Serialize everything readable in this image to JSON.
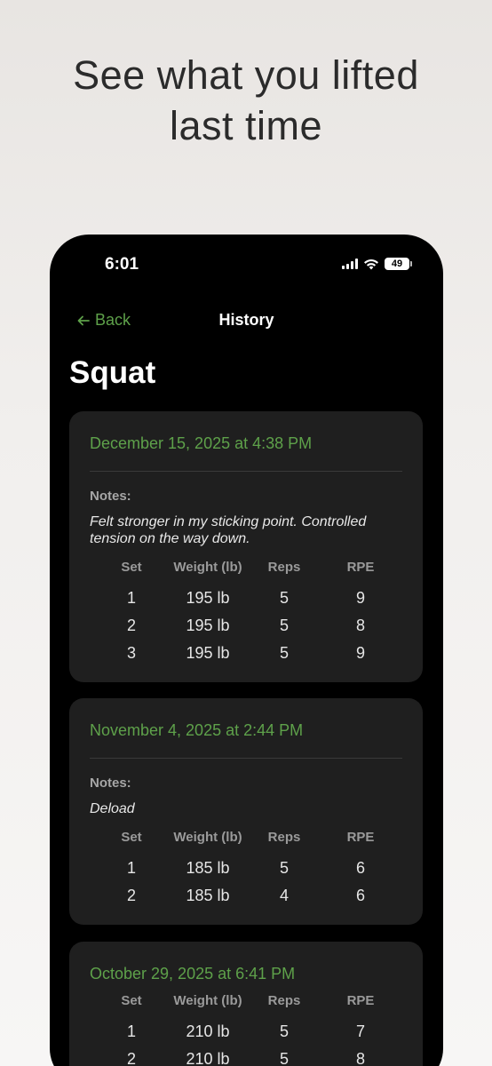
{
  "headline": {
    "line1": "See what you lifted",
    "line2": "last time"
  },
  "status_bar": {
    "time": "6:01",
    "battery": "49",
    "icons": [
      "signal-icon",
      "wifi-icon",
      "battery-icon"
    ]
  },
  "nav": {
    "back_label": "Back",
    "back_icon": "arrow-left-icon",
    "title": "History"
  },
  "exercise": "Squat",
  "colors": {
    "accent": "#5ea14a",
    "card": "#1f1f1f",
    "screen": "#000000"
  },
  "columns": [
    "Set",
    "Weight (lb)",
    "Reps",
    "RPE"
  ],
  "sessions": [
    {
      "date": "December 15, 2025 at 4:38 PM",
      "notes_label": "Notes:",
      "notes_line1": "Felt stronger in my sticking point. Controlled",
      "notes_line2": "tension on the way down.",
      "sets": [
        [
          "1",
          "195 lb",
          "5",
          "9"
        ],
        [
          "2",
          "195 lb",
          "5",
          "8"
        ],
        [
          "3",
          "195 lb",
          "5",
          "9"
        ]
      ]
    },
    {
      "date": "November 4, 2025 at 2:44 PM",
      "notes_label": "Notes:",
      "notes_line1": "Deload",
      "sets": [
        [
          "1",
          "185 lb",
          "5",
          "6"
        ],
        [
          "2",
          "185 lb",
          "4",
          "6"
        ]
      ]
    },
    {
      "date": "October 29, 2025 at 6:41 PM",
      "sets": [
        [
          "1",
          "210 lb",
          "5",
          "7"
        ],
        [
          "2",
          "210 lb",
          "5",
          "8"
        ]
      ]
    }
  ]
}
